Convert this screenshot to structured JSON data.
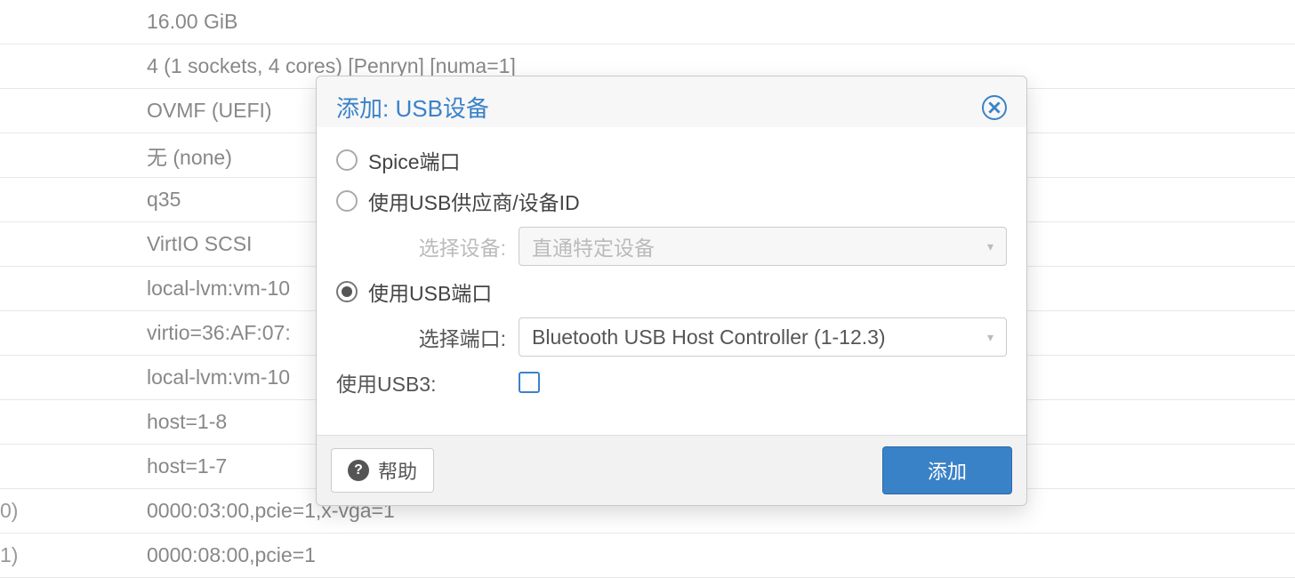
{
  "bgRows": [
    "16.00 GiB",
    "4 (1 sockets, 4 cores) [Penryn] [numa=1]",
    "OVMF (UEFI)",
    "无 (none)",
    "q35",
    "VirtIO SCSI",
    "local-lvm:vm-10",
    "virtio=36:AF:07:",
    "local-lvm:vm-10",
    "host=1-8",
    "host=1-7"
  ],
  "bgBottom": {
    "left0": "0)",
    "val0": "0000:03:00,pcie=1,x-vga=1",
    "left1": "1)",
    "val1": "0000:08:00,pcie=1"
  },
  "modal": {
    "title": "添加: USB设备",
    "radios": {
      "spice": "Spice端口",
      "vendor": "使用USB供应商/设备ID",
      "port": "使用USB端口"
    },
    "selectDeviceLabel": "选择设备:",
    "selectDeviceValue": "直通特定设备",
    "selectPortLabel": "选择端口:",
    "selectPortValue": "Bluetooth USB Host Controller (1-12.3)",
    "usb3Label": "使用USB3:",
    "helpLabel": "帮助",
    "addLabel": "添加"
  }
}
